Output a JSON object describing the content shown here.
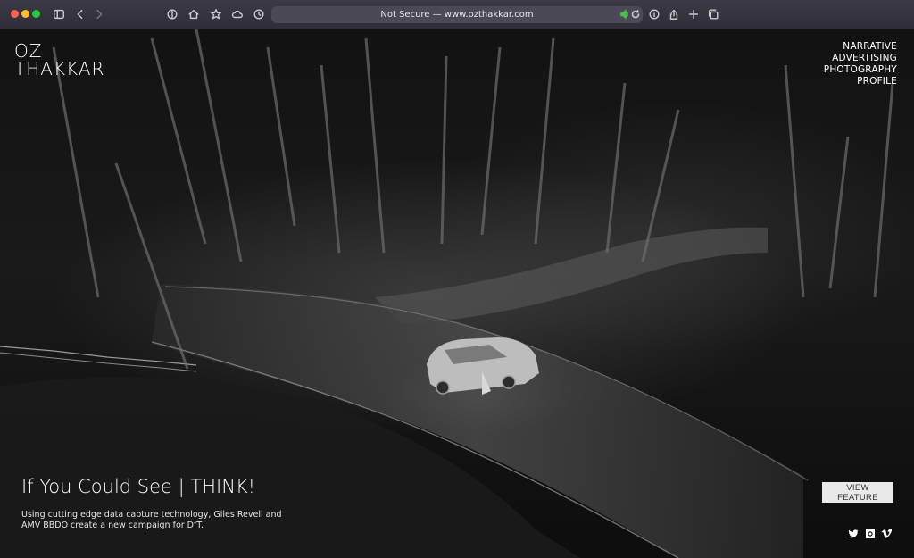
{
  "browser": {
    "url_text": "Not Secure — www.ozthakkar.com",
    "icons": [
      "sidebar-icon",
      "back-icon",
      "forward-icon",
      "shield-icon",
      "home-icon",
      "star-icon",
      "cloud-icon",
      "clock-icon",
      "speaker-icon",
      "reload-icon",
      "info-icon",
      "share-icon",
      "plus-icon",
      "tabs-icon"
    ]
  },
  "site": {
    "logo_line1": "OZ",
    "logo_line2": "THAKKAR",
    "nav": [
      "NARRATIVE",
      "ADVERTISING",
      "PHOTOGRAPHY",
      "PROFILE"
    ]
  },
  "feature": {
    "title": "If You Could See | THINK!",
    "description": "Using cutting edge data capture technology, Giles Revell and AMV BBDO create a new campaign for DfT.",
    "button_label": "VIEW FEATURE"
  },
  "social": [
    "twitter-icon",
    "instagram-icon",
    "vimeo-icon"
  ],
  "colors": {
    "chrome_bg": "#35343e",
    "button_bg": "#e9e9e9",
    "text": "#ffffff"
  }
}
